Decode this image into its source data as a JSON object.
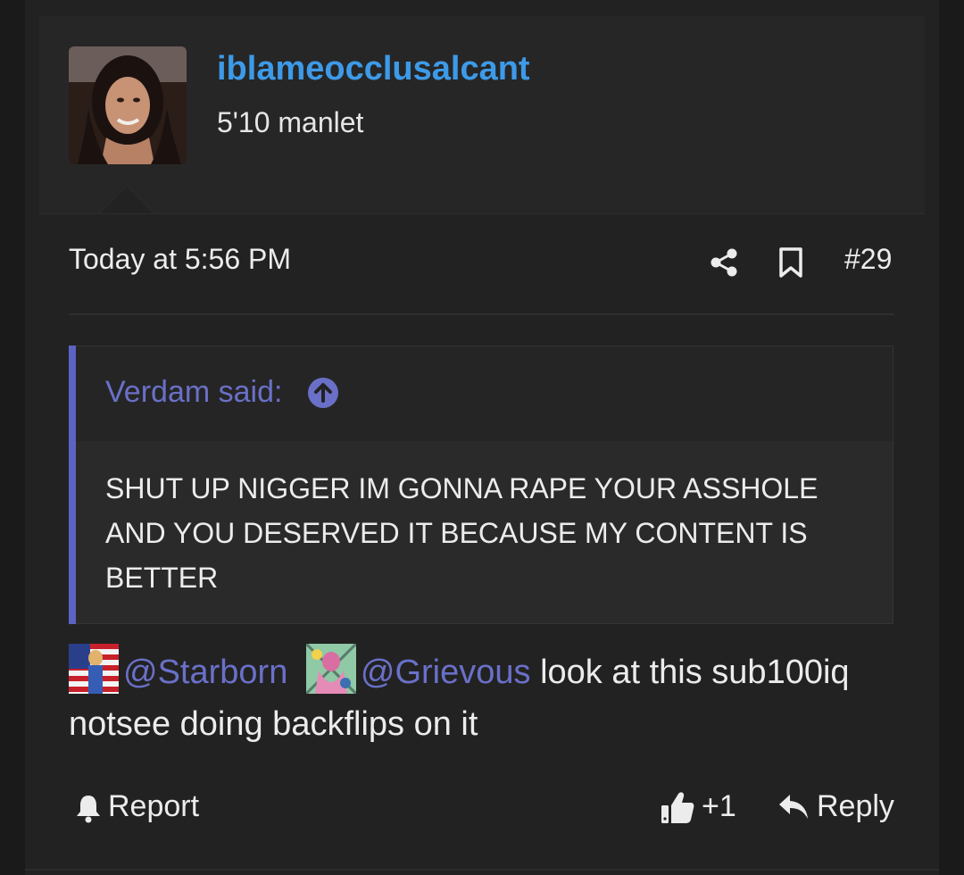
{
  "user": {
    "username": "iblameocclusalcant",
    "title": "5'10 manlet",
    "avatar_icon": "user-avatar-photo"
  },
  "post": {
    "timestamp": "Today at 5:56 PM",
    "number": "#29",
    "share_icon": "share-icon",
    "bookmark_icon": "bookmark-icon"
  },
  "quote": {
    "author_label": "Verdam said:",
    "jump_icon": "arrow-up-circle-icon",
    "text": "SHUT UP NIGGER IM GONNA RAPE YOUR ASSHOLE AND YOU DESERVED IT BECAUSE MY CONTENT IS BETTER"
  },
  "message": {
    "mention_1": "@Starborn",
    "mention_2": "@Grievous",
    "text": " look at this sub100iq notsee doing backflips on it"
  },
  "actions": {
    "report_label": "Report",
    "like_count": "+1",
    "reply_label": "Reply"
  },
  "colors": {
    "username": "#3d9ae8",
    "mention": "#6a70c8",
    "quote_bar": "#5c63c4",
    "background": "#222222"
  }
}
